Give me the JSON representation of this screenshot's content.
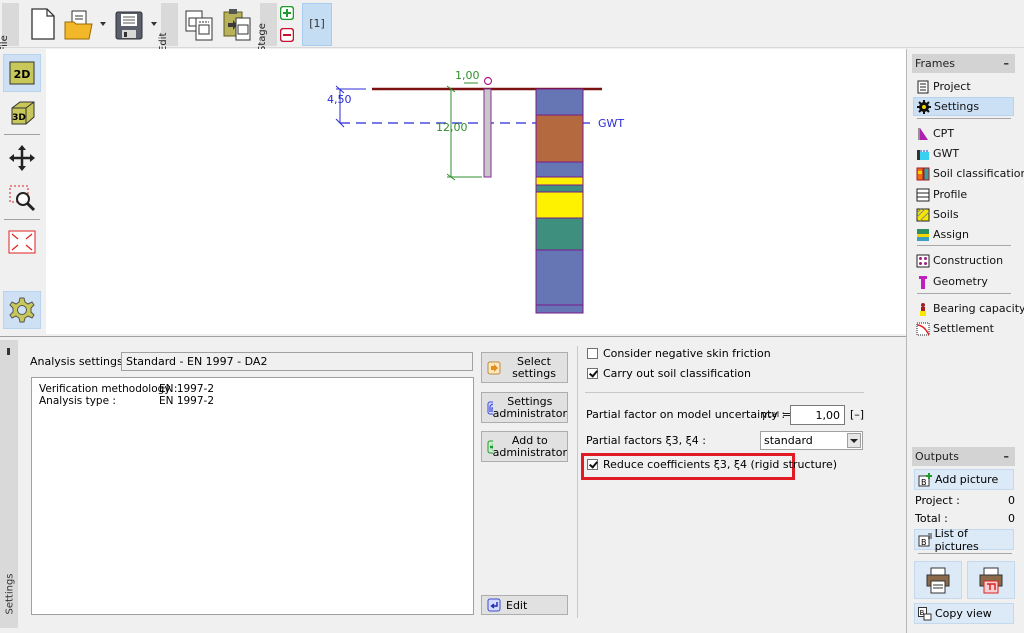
{
  "toolbar": {
    "file_tab": "File",
    "edit_tab": "Edit",
    "stage_tab": "Stage",
    "stage_current": "[1]",
    "icons": [
      "new-file-icon",
      "open-folder-icon",
      "save-floppy-icon",
      "copy-icon",
      "paste-icon",
      "add-stage-icon",
      "remove-stage-icon"
    ]
  },
  "left_tools": {
    "items": [
      {
        "name": "2d-view",
        "label": "2D",
        "active": true
      },
      {
        "name": "3d-view",
        "label": "3D",
        "active": false
      },
      {
        "name": "move",
        "label": "",
        "active": false
      },
      {
        "name": "zoom",
        "label": "",
        "active": false
      },
      {
        "name": "fit-extents",
        "label": "",
        "active": false
      },
      {
        "name": "settings",
        "label": "",
        "active": true
      }
    ]
  },
  "drawing": {
    "dim_gwt_depth": "4,50",
    "dim_pile_top": "1,00",
    "dim_pile_length": "12,00",
    "gwt_label": "GWT",
    "colors": {
      "terrain": "#7a1212",
      "dim_blue": "#2b2bd6",
      "dim_green": "#2f8f2f",
      "pile_fill": "#c8c8c8",
      "pile_border": "#8a2a9a",
      "layer_border": "#7a1a8a"
    },
    "cpt_layers": [
      {
        "color": "#6676b4",
        "thickness": 26
      },
      {
        "color": "#b4693e",
        "thickness": 47
      },
      {
        "color": "#6676b4",
        "thickness": 15
      },
      {
        "color": "#fff200",
        "thickness": 8
      },
      {
        "color": "#3f8f7f",
        "thickness": 7
      },
      {
        "color": "#fff200",
        "thickness": 26
      },
      {
        "color": "#3f8f7f",
        "thickness": 32
      },
      {
        "color": "#6676b4",
        "thickness": 55
      },
      {
        "color": "#6676b4",
        "thickness": 8
      }
    ]
  },
  "frames": {
    "title": "Frames",
    "minimize": "–",
    "items": [
      {
        "label": "Project",
        "icon": "project-icon",
        "active": false
      },
      {
        "label": "Settings",
        "icon": "settings-gear-icon",
        "active": true
      },
      {
        "label": "CPT",
        "icon": "cpt-icon",
        "active": false
      },
      {
        "label": "GWT",
        "icon": "gwt-icon",
        "active": false
      },
      {
        "label": "Soil classification",
        "icon": "soil-classification-icon",
        "active": false
      },
      {
        "label": "Profile",
        "icon": "profile-icon",
        "active": false
      },
      {
        "label": "Soils",
        "icon": "soils-icon",
        "active": false
      },
      {
        "label": "Assign",
        "icon": "assign-icon",
        "active": false
      },
      {
        "label": "Construction",
        "icon": "construction-icon",
        "active": false
      },
      {
        "label": "Geometry",
        "icon": "geometry-icon",
        "active": false
      },
      {
        "label": "Bearing capacity",
        "icon": "bearing-capacity-icon",
        "active": false
      },
      {
        "label": "Settlement",
        "icon": "settlement-icon",
        "active": false
      }
    ]
  },
  "outputs": {
    "title": "Outputs",
    "minimize": "–",
    "add_picture": "Add picture",
    "project_label": "Project :",
    "project_count": "0",
    "total_label": "Total :",
    "total_count": "0",
    "list_of_pictures": "List of pictures",
    "copy_view": "Copy view"
  },
  "settings_panel": {
    "vertical_tab": "Settings",
    "analysis_settings_label": "Analysis settings :",
    "analysis_settings_value": "Standard - EN 1997 - DA2",
    "details": [
      {
        "key": "Verification methodology :",
        "value": "EN 1997-2"
      },
      {
        "key": "Analysis type :",
        "value": "EN 1997-2"
      }
    ],
    "buttons": {
      "select_settings": [
        "Select",
        "settings"
      ],
      "settings_administrator": [
        "Settings",
        "administrator"
      ],
      "add_to_administrator": [
        "Add to",
        "administrator"
      ],
      "edit": "Edit"
    },
    "options": {
      "negative_skin_friction": {
        "label": "Consider negative skin friction",
        "checked": false
      },
      "soil_classification": {
        "label": "Carry out soil classification",
        "checked": true
      },
      "partial_factor_label": "Partial factor on model uncertainty :",
      "gamma_cal_symbol": "γ",
      "gamma_cal_sub": "cal",
      "gamma_cal_eq": "=",
      "gamma_cal_value": "1,00",
      "gamma_cal_unit": "[–]",
      "partial_factors_label": "Partial factors ξ3, ξ4 :",
      "partial_factors_value": "standard",
      "reduce_coefficients": {
        "label": "Reduce coefficients ξ3, ξ4 (rigid structure)",
        "checked": true
      },
      "highlight_color": "#e01b24"
    }
  }
}
